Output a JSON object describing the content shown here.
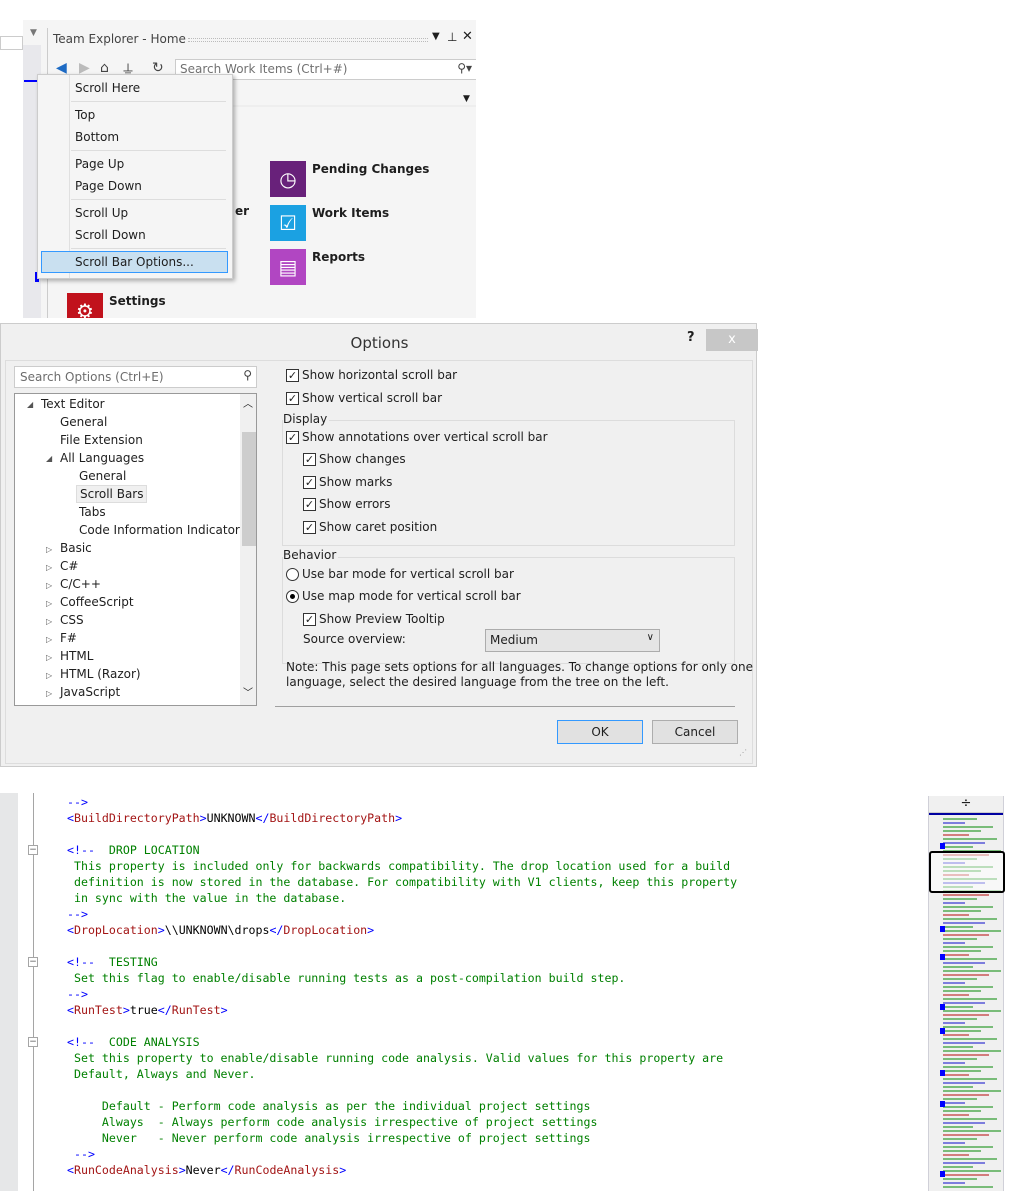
{
  "team_explorer": {
    "title": "Team Explorer - Home",
    "search_placeholder": "Search Work Items (Ctrl+#)",
    "tiles": [
      {
        "label": "Pending Changes",
        "color": "#68217a",
        "icon": "clock-icon"
      },
      {
        "label": "Work Items",
        "color": "#1ba1e2",
        "icon": "checklist-icon"
      },
      {
        "label": "Reports",
        "color": "#b146c2",
        "icon": "report-icon"
      },
      {
        "label": "Settings",
        "color": "#c1121c",
        "icon": "gear-icon"
      }
    ],
    "partial_label": "er"
  },
  "context_menu": {
    "items": [
      "Scroll Here",
      "Top",
      "Bottom",
      "Page Up",
      "Page Down",
      "Scroll Up",
      "Scroll Down",
      "Scroll Bar Options..."
    ],
    "selected": "Scroll Bar Options..."
  },
  "options": {
    "title": "Options",
    "help": "?",
    "close": "x",
    "search_placeholder": "Search Options (Ctrl+E)",
    "tree": [
      "Text Editor",
      "General",
      "File Extension",
      "All Languages",
      "General",
      "Scroll Bars",
      "Tabs",
      "Code Information Indicators",
      "Basic",
      "C#",
      "C/C++",
      "CoffeeScript",
      "CSS",
      "F#",
      "HTML",
      "HTML (Razor)",
      "JavaScript"
    ],
    "show_horizontal": "Show horizontal scroll bar",
    "show_vertical": "Show vertical scroll bar",
    "display_group": "Display",
    "show_annotations": "Show annotations over vertical scroll bar",
    "show_changes": "Show changes",
    "show_marks": "Show marks",
    "show_errors": "Show errors",
    "show_caret": "Show caret position",
    "behavior_group": "Behavior",
    "bar_mode": "Use bar mode for vertical scroll bar",
    "map_mode": "Use map mode for vertical scroll bar",
    "preview_tooltip": "Show Preview Tooltip",
    "source_overview_label": "Source overview:",
    "source_overview_value": "Medium",
    "note_line1": "Note: This page sets options for all languages. To change options for only one",
    "note_line2": "language, select the desired language from the tree on the left.",
    "ok": "OK",
    "cancel": "Cancel"
  },
  "code": {
    "lines": [
      [
        [
          "-->",
          "br"
        ]
      ],
      [
        [
          "<",
          "br"
        ],
        [
          "BuildDirectoryPath",
          "tag"
        ],
        [
          ">",
          "br"
        ],
        [
          "UNKNOWN",
          "txt"
        ],
        [
          "</",
          "br"
        ],
        [
          "BuildDirectoryPath",
          "tag"
        ],
        [
          ">",
          "br"
        ]
      ],
      [],
      [
        [
          "<!--",
          "br"
        ],
        [
          "  DROP LOCATION",
          "com"
        ]
      ],
      [
        [
          " This property is included only for backwards compatibility. The drop location used for a build",
          "com"
        ]
      ],
      [
        [
          " definition is now stored in the database. For compatibility with V1 clients, keep this property",
          "com"
        ]
      ],
      [
        [
          " in sync with the value in the database.",
          "com"
        ]
      ],
      [
        [
          "-->",
          "br"
        ]
      ],
      [
        [
          "<",
          "br"
        ],
        [
          "DropLocation",
          "tag"
        ],
        [
          ">",
          "br"
        ],
        [
          "\\\\UNKNOWN\\drops",
          "txt"
        ],
        [
          "</",
          "br"
        ],
        [
          "DropLocation",
          "tag"
        ],
        [
          ">",
          "br"
        ]
      ],
      [],
      [
        [
          "<!--",
          "br"
        ],
        [
          "  TESTING",
          "com"
        ]
      ],
      [
        [
          " Set this flag to enable/disable running tests as a post-compilation build step.",
          "com"
        ]
      ],
      [
        [
          "-->",
          "br"
        ]
      ],
      [
        [
          "<",
          "br"
        ],
        [
          "RunTest",
          "tag"
        ],
        [
          ">",
          "br"
        ],
        [
          "true",
          "txt"
        ],
        [
          "</",
          "br"
        ],
        [
          "RunTest",
          "tag"
        ],
        [
          ">",
          "br"
        ]
      ],
      [],
      [
        [
          "<!--",
          "br"
        ],
        [
          "  CODE ANALYSIS",
          "com"
        ]
      ],
      [
        [
          " Set this property to enable/disable running code analysis. Valid values for this property are",
          "com"
        ]
      ],
      [
        [
          " Default, Always and Never.",
          "com"
        ]
      ],
      [],
      [
        [
          "     Default - Perform code analysis as per the individual project settings",
          "com"
        ]
      ],
      [
        [
          "     Always  - Always perform code analysis irrespective of project settings",
          "com"
        ]
      ],
      [
        [
          "     Never   - Never perform code analysis irrespective of project settings",
          "com"
        ]
      ],
      [
        [
          " -->",
          "br"
        ]
      ],
      [
        [
          "<",
          "br"
        ],
        [
          "RunCodeAnalysis",
          "tag"
        ],
        [
          ">",
          "br"
        ],
        [
          "Never",
          "txt"
        ],
        [
          "</",
          "br"
        ],
        [
          "RunCodeAnalysis",
          "tag"
        ],
        [
          ">",
          "br"
        ]
      ]
    ]
  }
}
